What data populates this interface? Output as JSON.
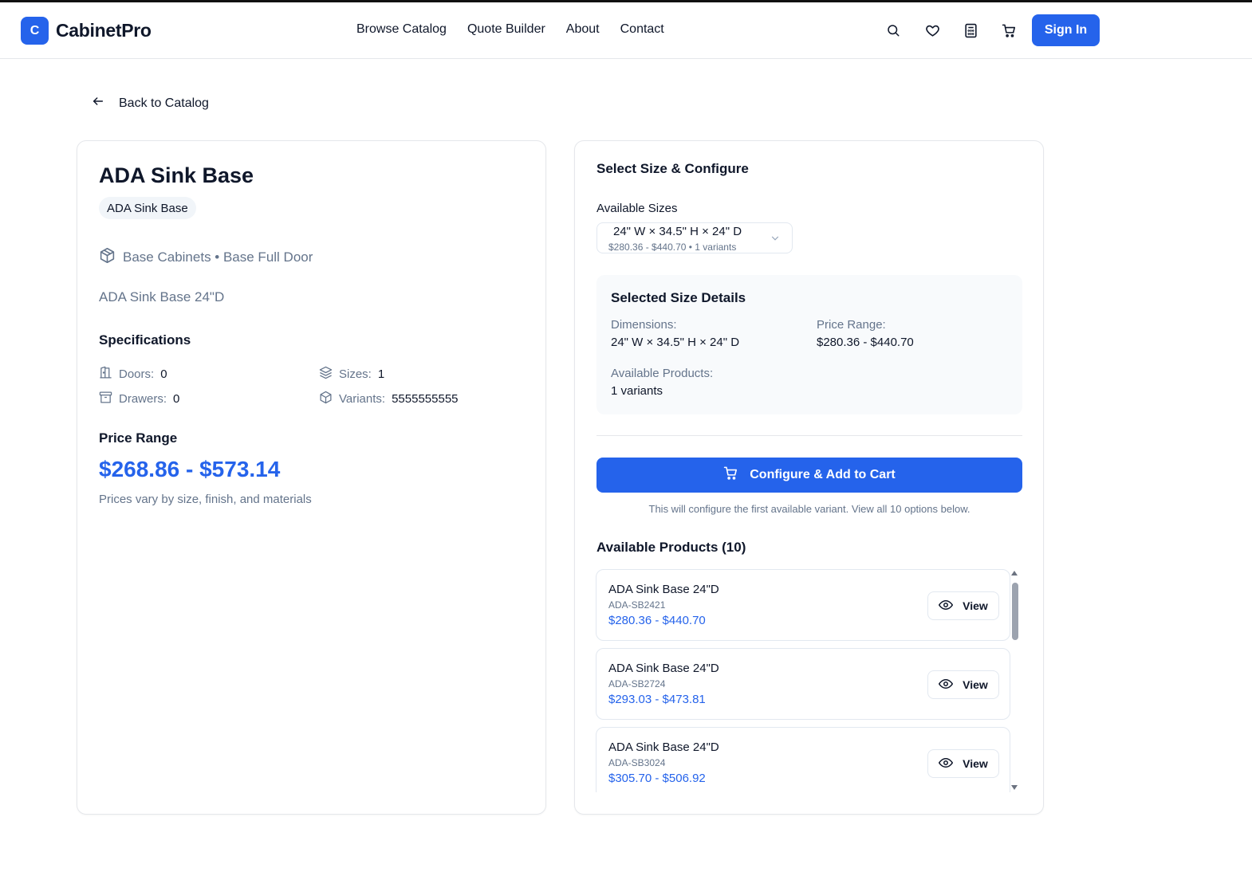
{
  "header": {
    "logo_letter": "C",
    "brand": "CabinetPro",
    "nav": [
      "Browse Catalog",
      "Quote Builder",
      "About",
      "Contact"
    ],
    "icons": [
      "search-icon",
      "heart-icon",
      "calculator-icon",
      "cart-icon"
    ],
    "sign_in": "Sign In"
  },
  "back_link": "Back to Catalog",
  "product": {
    "title": "ADA Sink Base",
    "badge": "ADA Sink Base",
    "category": "Base Cabinets • Base Full Door",
    "description": "ADA Sink Base 24\"D",
    "specs_title": "Specifications",
    "specs": {
      "doors_label": "Doors:",
      "doors": "0",
      "drawers_label": "Drawers:",
      "drawers": "0",
      "sizes_label": "Sizes:",
      "sizes": "1",
      "variants_label": "Variants:",
      "variants": "5555555555"
    },
    "price_title": "Price Range",
    "price": "$268.86 - $573.14",
    "price_note": "Prices vary by size, finish, and materials"
  },
  "configure": {
    "title": "Select Size & Configure",
    "sizes_label": "Available Sizes",
    "selected_size": "24\" W × 34.5\" H × 24\" D",
    "selected_size_sub": "$280.36 - $440.70 • 1 variants",
    "details": {
      "title": "Selected Size Details",
      "dimensions_label": "Dimensions:",
      "dimensions": "24\" W × 34.5\" H × 24\" D",
      "price_range_label": "Price Range:",
      "price_range": "$280.36 - $440.70",
      "products_label": "Available Products:",
      "products": "1 variants"
    },
    "cta": "Configure & Add to Cart",
    "cta_note": "This will configure the first available variant. View all 10 options below.",
    "products_title": "Available Products (10)",
    "view_label": "View",
    "products": [
      {
        "name": "ADA Sink Base 24\"D",
        "sku": "ADA-SB2421",
        "price": "$280.36 - $440.70"
      },
      {
        "name": "ADA Sink Base 24\"D",
        "sku": "ADA-SB2724",
        "price": "$293.03 - $473.81"
      },
      {
        "name": "ADA Sink Base 24\"D",
        "sku": "ADA-SB3024",
        "price": "$305.70 - $506.92"
      }
    ]
  },
  "colors": {
    "accent": "#2563eb",
    "muted": "#64748b",
    "text": "#0f172a"
  }
}
